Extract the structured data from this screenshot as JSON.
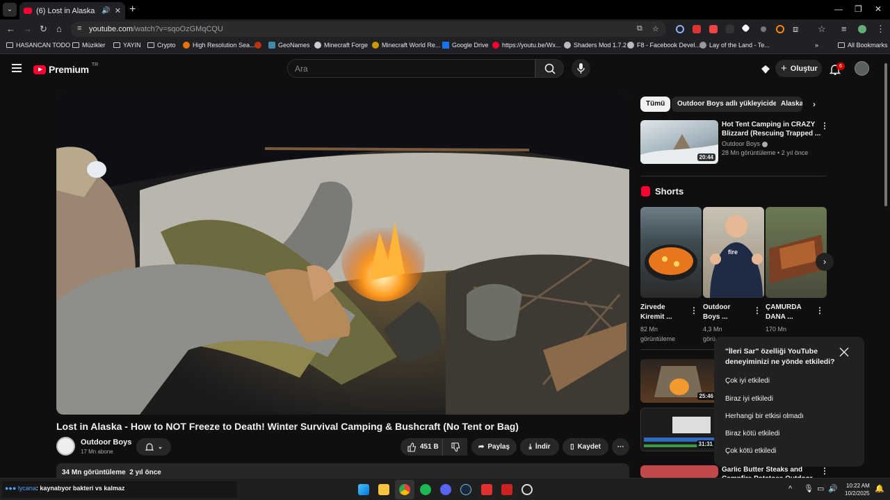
{
  "browser": {
    "tab_title": "(6) Lost in Alaska - How to NOT",
    "url_host": "youtube.com",
    "url_path": "/watch?v=sqoOzGMqCQU",
    "bookmarks": [
      "HASANCAN TODO",
      "Müzikler",
      "YAYIN",
      "Crypto",
      "High Resolution Sea...",
      "GeoNames",
      "Minecraft Forge",
      "Minecraft World Re...",
      "Google Drive",
      "https://youtu.be/Wx...",
      "Shaders Mod 1.7.2",
      "F8 - Facebook Devel...",
      "Lay of the Land - Te..."
    ],
    "all_bookmarks": "All Bookmarks"
  },
  "yt": {
    "logo": "Premium",
    "region": "TR",
    "search_placeholder": "Ara",
    "create_label": "Oluştur",
    "notif_count": "6"
  },
  "video": {
    "title": "Lost in Alaska - How to NOT Freeze to Death! Winter Survival Camping & Bushcraft (No Tent or Bag)",
    "channel": "Outdoor Boys",
    "subscribers": "17 Mn abone",
    "likes": "451 B",
    "share": "Paylaş",
    "download": "İndir",
    "save": "Kaydet",
    "views": "34 Mn görüntüleme",
    "age": "2 yıl önce"
  },
  "sidebar": {
    "chips": [
      "Tümü",
      "Outdoor Boys adlı yükleyiciden",
      "Alaska"
    ],
    "rec1": {
      "title1": "Hot Tent Camping in CRAZY",
      "title2": "Blizzard (Rescuing Trapped ...",
      "channel": "Outdoor Boys",
      "meta": "28 Mn görüntüleme • 2 yıl önce",
      "duration": "20:44"
    },
    "shorts_label": "Shorts",
    "shorts": [
      {
        "t1": "Zirvede",
        "t2": "Kiremit ...",
        "m1": "82 Mn",
        "m2": "görüntüleme"
      },
      {
        "t1": "Outdoor",
        "t2": "Boys ...",
        "m1": "4,3 Mn",
        "m2": "görü"
      },
      {
        "t1": "ÇAMURDA",
        "t2": "DANA ...",
        "m1": "170 Mn",
        "m2": ""
      }
    ],
    "short2_caption": "fire",
    "rec2_duration": "25:46",
    "rec3_duration": "31:31",
    "rec4_title1": "Garlic Butter Steaks and",
    "rec4_title2": "Campfire Potatoes Outdoor"
  },
  "survey": {
    "question": "\"İleri Sar\" özelliği YouTube deneyiminizi ne yönde etkiledi?",
    "options": [
      "Çok iyi etkiledi",
      "Biraz iyi etkiledi",
      "Herhangi bir etkisi olmadı",
      "Biraz kötü etkiledi",
      "Çok kötü etkiledi"
    ]
  },
  "taskbar": {
    "widget_user": "lycana",
    "widget_text": ": kaynatıyor bakteri vs kalmaz",
    "time": "10:22 AM",
    "date": "10/2/2025"
  },
  "colors": {
    "yt_red": "#ff0033",
    "bg": "#0f0f0f",
    "chip": "#272727"
  }
}
